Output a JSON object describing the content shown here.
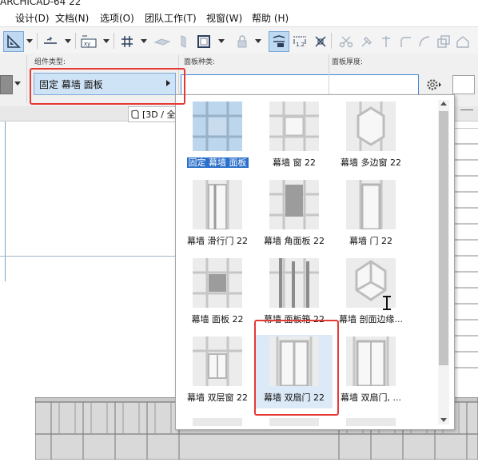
{
  "window": {
    "title": "ARCHICAD-64 22"
  },
  "menu": [
    {
      "label": "设计(D)"
    },
    {
      "label": "文档(N)"
    },
    {
      "label": "选项(O)"
    },
    {
      "label": "团队工作(T)"
    },
    {
      "label": "视窗(W)"
    },
    {
      "label": "帮助 (H)"
    }
  ],
  "infobox": {
    "member_type_label": "组件类型:",
    "panel_type_label": "面板种类:",
    "panel_thickness_label": "面板厚度:",
    "member_type_value": "固定 幕墙 面板",
    "panel_name_value": "",
    "panel_thickness_value": ""
  },
  "view_tab": {
    "label": "[3D / 全"
  },
  "gallery": {
    "items": [
      {
        "label": "固定 幕墙 面板",
        "icon": "fixed-panel-thumb"
      },
      {
        "label": "幕墙 窗 22",
        "icon": "window-thumb"
      },
      {
        "label": "幕墙 多边窗 22",
        "icon": "polygon-window-thumb"
      },
      {
        "label": "幕墙 滑行门 22",
        "icon": "sliding-door-thumb"
      },
      {
        "label": "幕墙 角面板 22",
        "icon": "corner-panel-thumb"
      },
      {
        "label": "幕墙 门 22",
        "icon": "door-thumb"
      },
      {
        "label": "幕墙 面板 22",
        "icon": "panel-thumb"
      },
      {
        "label": "幕墙 面板箱 22",
        "icon": "panel-box-thumb"
      },
      {
        "label": "幕墙 剖面边缘...",
        "icon": "section-edge-thumb"
      },
      {
        "label": "幕墙 双层窗 22",
        "icon": "double-window-thumb"
      },
      {
        "label": "幕墙 双扇门 22",
        "icon": "double-door-thumb"
      },
      {
        "label": "幕墙 双扇门, ...",
        "icon": "double-door-2-thumb"
      }
    ],
    "selected_index": 0,
    "highlighted_index": 10
  },
  "colors": {
    "highlight_red": "#e53935",
    "selection_blue": "#2a6fc9",
    "field_focus_blue": "#3f86d6",
    "toolbar_accent": "#bfd9f2"
  }
}
